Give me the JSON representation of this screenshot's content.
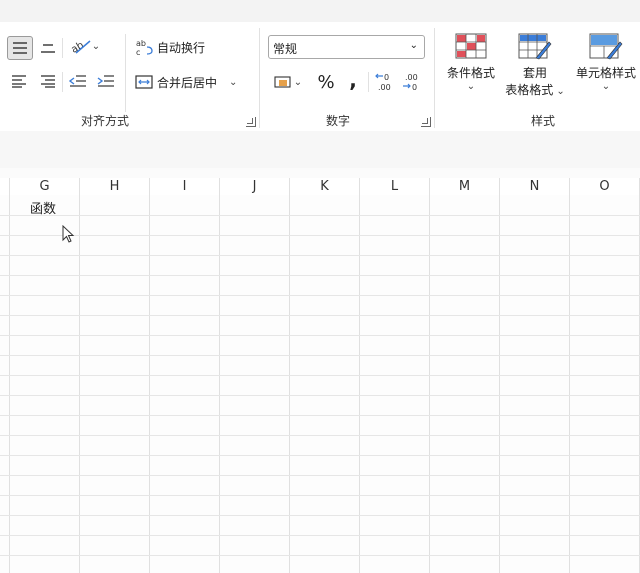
{
  "ribbon": {
    "alignment": {
      "group_label": "对齐方式",
      "wrap_text": "自动换行",
      "merge_center": "合并后居中"
    },
    "number": {
      "group_label": "数字",
      "format_value": "常规",
      "percent": "%",
      "comma": ","
    },
    "styles": {
      "group_label": "样式",
      "conditional_format": "条件格式",
      "table_format_line1": "套用",
      "table_format_line2": "表格格式",
      "cell_styles": "单元格样式"
    }
  },
  "sheet": {
    "columns": [
      "G",
      "H",
      "I",
      "J",
      "K",
      "L",
      "M",
      "N",
      "O"
    ],
    "cell_G1": "函数"
  },
  "colors": {
    "red_accent": "#e0505a",
    "blue_accent": "#3b7dd8"
  }
}
